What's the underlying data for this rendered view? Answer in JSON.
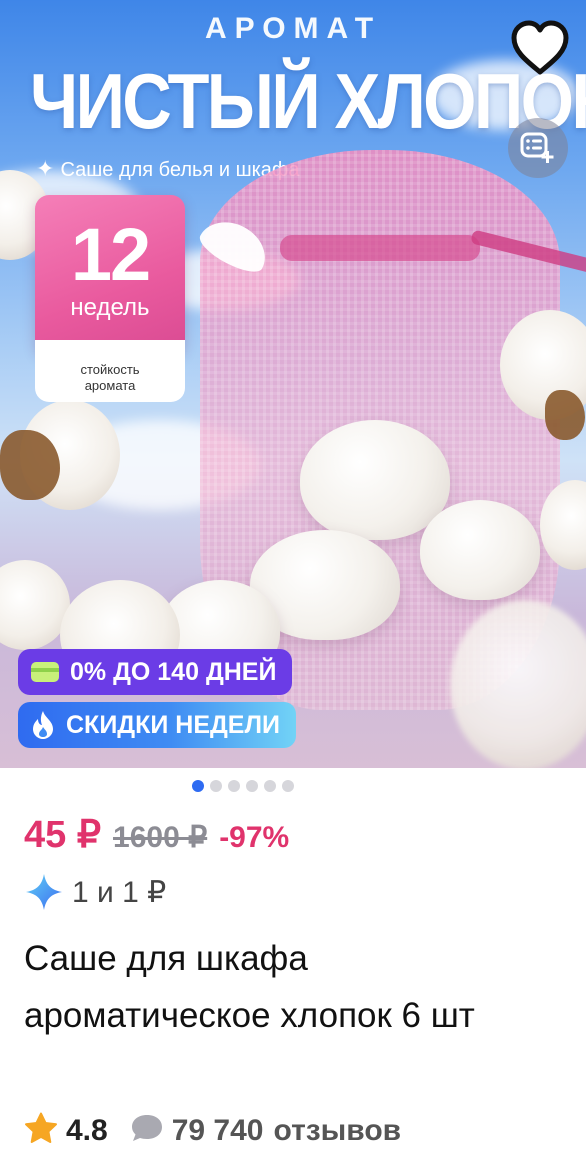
{
  "hero_image": {
    "overline": "АРОМАТ",
    "headline": "ЧИСТЫЙ ХЛОПОК",
    "subline": "Саше для белья и шкафа",
    "badge_number": "12",
    "badge_unit": "недель",
    "badge_note_line1": "стойкость",
    "badge_note_line2": "аромата"
  },
  "actions": {
    "favorite_icon": "heart-icon",
    "collection_icon": "add-to-collection-icon"
  },
  "promos": [
    {
      "label": "0% ДО 140 ДНЕЙ",
      "icon": "card-icon",
      "color": "#6b3ce6"
    },
    {
      "label": "СКИДКИ НЕДЕЛИ",
      "icon": "fire-icon",
      "color": "#2f6bf0"
    }
  ],
  "gallery": {
    "total_images": 6,
    "active_index": 0
  },
  "price": {
    "current": "45 ₽",
    "old": "1600 ₽",
    "discount": "-97%",
    "accent_color": "#e0336c"
  },
  "bonus": {
    "text": "1 и 1 ₽",
    "icon": "sparkle-icon"
  },
  "product": {
    "title": "Саше для шкафа ароматическое хлопок 6 шт"
  },
  "rating": {
    "value": "4.8",
    "reviews_count": "79 740",
    "reviews_label": "отзывов",
    "star_icon": "star-icon",
    "reviews_icon": "speech-bubble-icon"
  }
}
